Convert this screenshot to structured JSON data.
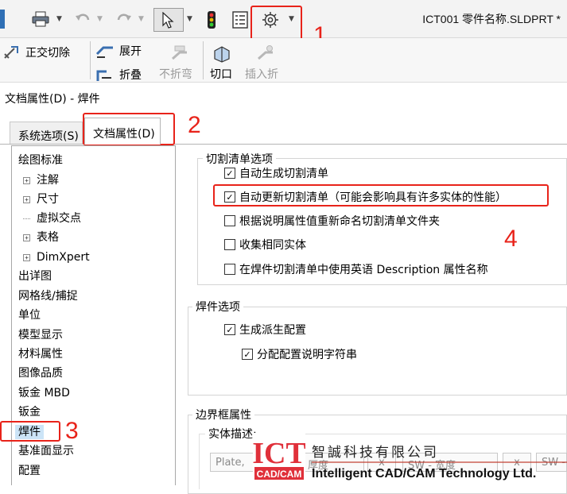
{
  "window": {
    "title": "ICT001 零件名称.SLDPRT *"
  },
  "toolbar": {
    "icons": [
      "print-icon",
      "undo-icon",
      "redo-icon",
      "select-pointer-icon",
      "traffic-light-icon",
      "file-properties-icon",
      "options-gear-icon"
    ]
  },
  "ribbon": {
    "orthogonal_cut": "正交切除",
    "expand": "展开",
    "fold": "折叠",
    "no_bend": "不折弯",
    "rip": "切口",
    "insert_bend": "插入折"
  },
  "dialog": {
    "title": "文档属性(D) - 焊件",
    "tabs": {
      "system": "系统选项(S)",
      "document": "文档属性(D)"
    }
  },
  "tree": {
    "items": [
      {
        "label": "绘图标准",
        "level": 0
      },
      {
        "label": "注解",
        "level": 1,
        "expandable": true
      },
      {
        "label": "尺寸",
        "level": 1,
        "expandable": true
      },
      {
        "label": "虚拟交点",
        "level": 1,
        "expandable": false
      },
      {
        "label": "表格",
        "level": 1,
        "expandable": true
      },
      {
        "label": "DimXpert",
        "level": 1,
        "expandable": true
      },
      {
        "label": "出详图",
        "level": 0
      },
      {
        "label": "网格线/捕捉",
        "level": 0
      },
      {
        "label": "单位",
        "level": 0
      },
      {
        "label": "模型显示",
        "level": 0
      },
      {
        "label": "材料属性",
        "level": 0
      },
      {
        "label": "图像品质",
        "level": 0
      },
      {
        "label": "钣金 MBD",
        "level": 0
      },
      {
        "label": "钣金",
        "level": 0
      },
      {
        "label": "焊件",
        "level": 0,
        "selected": true
      },
      {
        "label": "基准面显示",
        "level": 0
      },
      {
        "label": "配置",
        "level": 0
      }
    ],
    "expander_symbol": "+"
  },
  "cut_list": {
    "title": "切割清单选项",
    "options": [
      {
        "label": "自动生成切割清单",
        "checked": true
      },
      {
        "label": "自动更新切割清单（可能会影响具有许多实体的性能）",
        "checked": true
      },
      {
        "label": "根据说明属性值重新命名切割清单文件夹",
        "checked": false
      },
      {
        "label": "收集相同实体",
        "checked": false
      },
      {
        "label": "在焊件切割清单中使用英语 Description 属性名称",
        "checked": false
      }
    ]
  },
  "weldment": {
    "title": "焊件选项",
    "options": [
      {
        "label": "生成派生配置",
        "checked": true
      },
      {
        "label": "分配配置说明字符串",
        "checked": true
      }
    ]
  },
  "bbox": {
    "title": "边界框属性",
    "description_label": "实体描述:",
    "fields": [
      "Plate,",
      "SW - 厚度",
      "x",
      "SW - 宽度",
      "x",
      "SW -"
    ]
  },
  "check_mark": "✓",
  "annotations": [
    "1",
    "2",
    "3",
    "4"
  ],
  "watermark": {
    "logo_text": "ICT",
    "logo_sub": "CAD/CAM",
    "company_cn": "智誠科技有限公司",
    "company_en": "Intelligent CAD/CAM Technology Ltd."
  },
  "colors": {
    "annotation_red": "#e8231a",
    "selection_blue": "#cce4f7",
    "logo_red": "#e0303a"
  }
}
